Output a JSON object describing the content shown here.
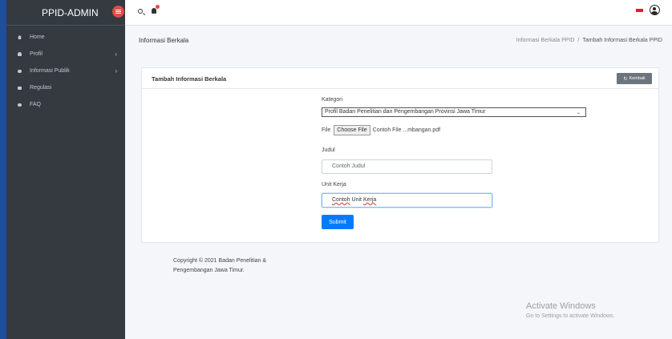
{
  "brand": {
    "title": "PPID-ADMIN"
  },
  "sidebar": {
    "items": [
      {
        "label": "Home",
        "icon": "house-icon"
      },
      {
        "label": "Profil",
        "icon": "user-icon",
        "chevron": "›"
      },
      {
        "label": "Informasi Publik",
        "icon": "chat-icon",
        "chevron": "›"
      },
      {
        "label": "Regulasi",
        "icon": "folder-icon"
      },
      {
        "label": "FAQ",
        "icon": "comments-icon"
      }
    ]
  },
  "header": {
    "page_title": "Informasi Berkala",
    "breadcrumb": [
      "Informasi Berkala PPID",
      "/",
      "Tambah Informasi Berkala PPID"
    ]
  },
  "card": {
    "title": "Tambah Informasi Berkala",
    "back_icon": "↻",
    "back_label": "Kembali"
  },
  "form": {
    "kategori_label": "Kategori",
    "kategori_value": "Profil Badan Penelitian dan Pengembangan Provinsi Jawa Timur",
    "select_arrow": "⌄",
    "file_label": "File",
    "file_button": "Choose File",
    "file_name": "Contoh File ...mbangan.pdf",
    "judul_label": "Judul",
    "judul_value": "Contoh Judul",
    "unit_label": "Unit Kerja",
    "unit_word1": "Contoh",
    "unit_word2": "Unit",
    "unit_word3": "Kerja",
    "submit_label": "Submit"
  },
  "footer": {
    "copyright": "Copyright © 2021 Badan Penelitian & Pengembangan Jawa Timur."
  },
  "watermark": {
    "title": "Activate Windows",
    "subtitle": "Go to Settings to activate Windows."
  },
  "colors": {
    "sidebar": "#343a40",
    "primary": "#007bff",
    "badge": "#e04b4b",
    "frame": "#1f4e9c"
  }
}
